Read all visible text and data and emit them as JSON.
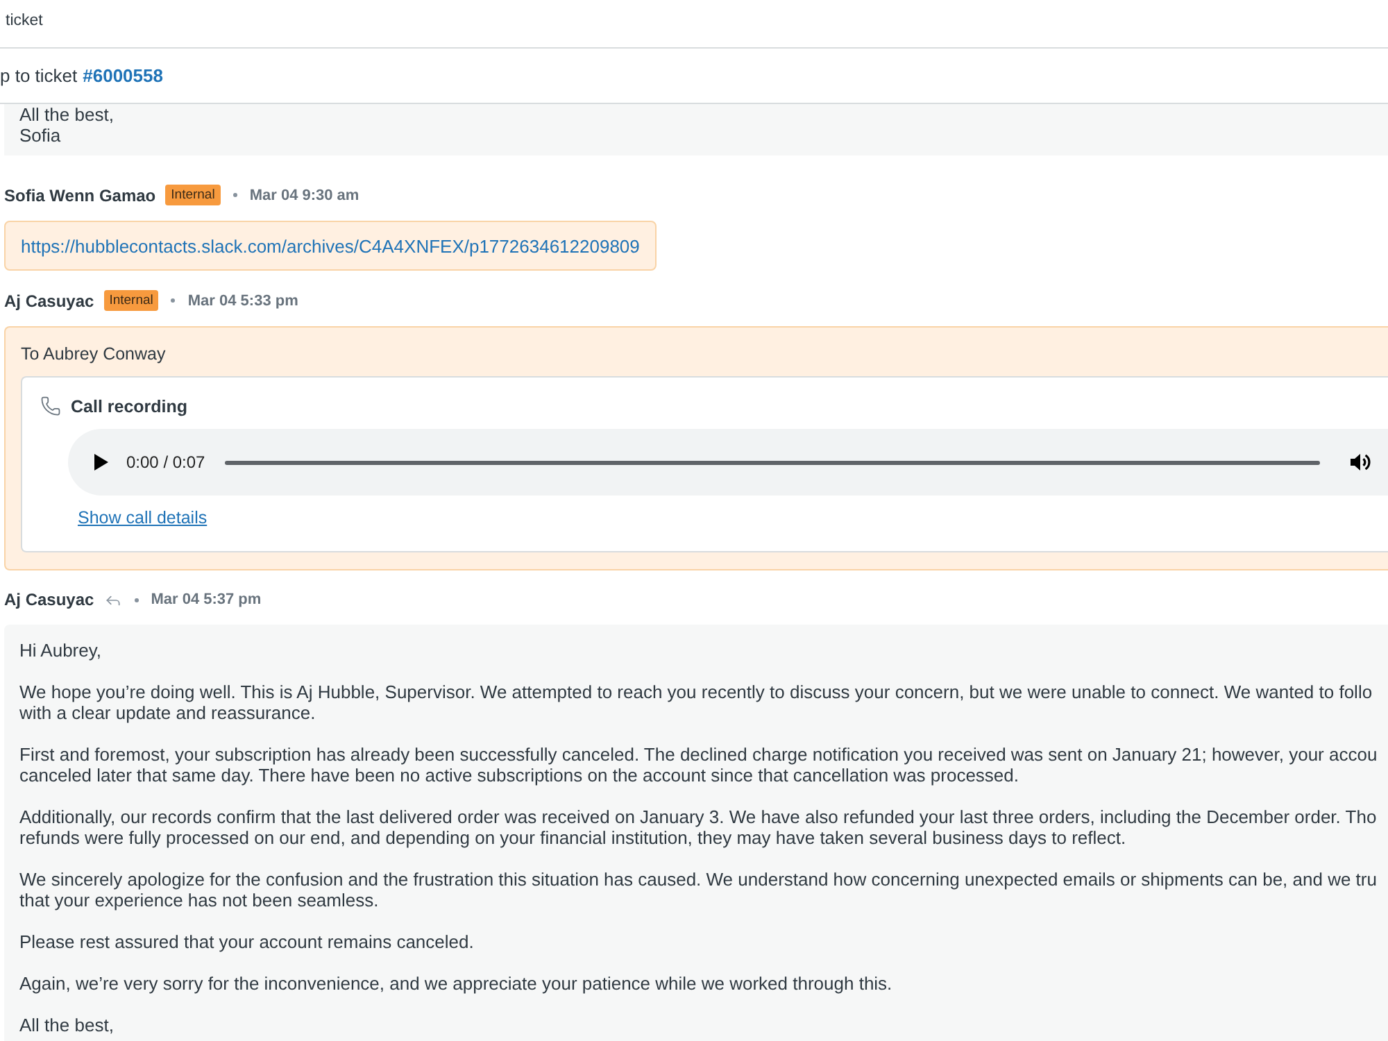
{
  "top_bar": {
    "subtitle": "ticket"
  },
  "jump_bar": {
    "label": "p to ticket",
    "ticket": "#6000558"
  },
  "messages": [
    {
      "kind": "tail",
      "paragraphs": [
        [
          "All the best,",
          "Sofia"
        ]
      ]
    },
    {
      "kind": "note",
      "author": "Sofia Wenn Gamao",
      "badge": "Internal",
      "time": "Mar 04 9:30 am",
      "link": "https://hubblecontacts.slack.com/archives/C4A4XNFEX/p1772634612209809"
    },
    {
      "kind": "call",
      "author": "Aj Casuyac",
      "badge": "Internal",
      "time": "Mar 04 5:33 pm",
      "recipient": "To Aubrey Conway",
      "recording": {
        "title": "Call recording",
        "time": "0:00 / 0:07",
        "details_link": "Show call details"
      }
    },
    {
      "kind": "email",
      "author": "Aj Casuyac",
      "time": "Mar 04 5:37 pm",
      "paragraphs": [
        [
          "Hi Aubrey,"
        ],
        [
          "We hope you’re doing well. This is Aj Hubble, Supervisor. We attempted to reach you recently to discuss your concern, but we were unable to connect. We wanted to follo",
          "with a clear update and reassurance."
        ],
        [
          "First and foremost, your subscription has already been successfully canceled. The declined charge notification you received was sent on January 21; however, your accou",
          "canceled later that same day. There have been no active subscriptions on the account since that cancellation was processed."
        ],
        [
          "Additionally, our records confirm that the last delivered order was received on January 3. We have also refunded your last three orders, including the December order. Tho",
          "refunds were fully processed on our end, and depending on your financial institution, they may have taken several business days to reflect."
        ],
        [
          "We sincerely apologize for the confusion and the frustration this situation has caused. We understand how concerning unexpected emails or shipments can be, and we tru",
          "that your experience has not been seamless."
        ],
        [
          "Please rest assured that your account remains canceled."
        ],
        [
          "Again, we’re very sorry for the inconvenience, and we appreciate your patience while we worked through this."
        ],
        [
          "All the best,"
        ]
      ]
    }
  ]
}
